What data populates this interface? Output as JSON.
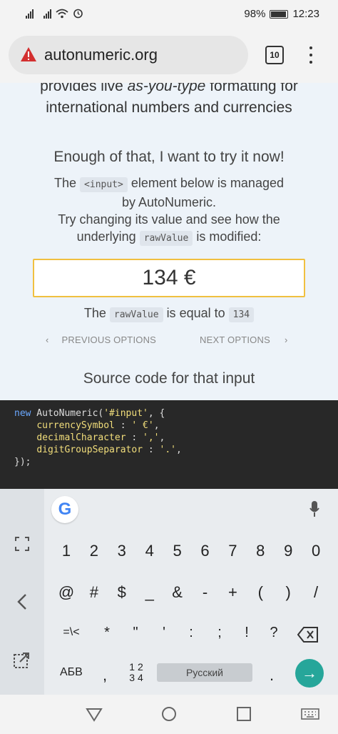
{
  "status_bar": {
    "battery_percent": "98%",
    "time": "12:23"
  },
  "browser": {
    "url": "autonumeric.org",
    "tab_count": "10"
  },
  "page": {
    "tagline_part1": "provides live ",
    "tagline_em": "as-you-type",
    "tagline_part2": " formatting for",
    "tagline_line2": "international numbers and currencies",
    "try_title": "Enough of that, I want to try it now!",
    "desc_the": "The",
    "desc_input_tag": "<input>",
    "desc_after_tag": "element below is managed",
    "desc_line2": "by AutoNumeric.",
    "desc_line3": "Try changing its value and see how the",
    "desc_line4_pre": "underlying",
    "desc_rawvalue": "rawValue",
    "desc_line4_post": "is modified:",
    "input_value": "134 €",
    "raw_pre": "The",
    "raw_label": "rawValue",
    "raw_mid": "is equal to",
    "raw_value": "134",
    "prev_options": "PREVIOUS OPTIONS",
    "next_options": "NEXT OPTIONS",
    "source_title": "Source code for that input"
  },
  "code": {
    "line1_kw": "new",
    "line1_rest": " AutoNumeric(",
    "line1_str": "'#input'",
    "line1_end": ", {",
    "line2_key": "currencySymbol",
    "line2_sep": " : ",
    "line2_val": "' €'",
    "line3_key": "decimalCharacter",
    "line3_sep": " : ",
    "line3_val": "','",
    "line4_key": "digitGroupSeparator",
    "line4_sep": " : ",
    "line4_val": "'.'",
    "line5": "});"
  },
  "keyboard": {
    "google_label": "G",
    "row1": [
      "1",
      "2",
      "3",
      "4",
      "5",
      "6",
      "7",
      "8",
      "9",
      "0"
    ],
    "row2": [
      "@",
      "#",
      "$",
      "_",
      "&",
      "-",
      "+",
      "(",
      ")",
      "/"
    ],
    "row3": [
      "=\\<",
      "*",
      "\"",
      "'",
      ":",
      ";",
      "!",
      "?"
    ],
    "abc_label": "АБВ",
    "comma": ",",
    "nums_top": "1 2",
    "nums_bottom": "3 4",
    "space_label": "Русский",
    "period": ".",
    "enter_symbol": "→"
  },
  "colors": {
    "page_bg": "#edf3f9",
    "input_border": "#f0c040",
    "code_bg": "#282828",
    "enter_key": "#26a69a",
    "warning": "#d32f2f"
  }
}
